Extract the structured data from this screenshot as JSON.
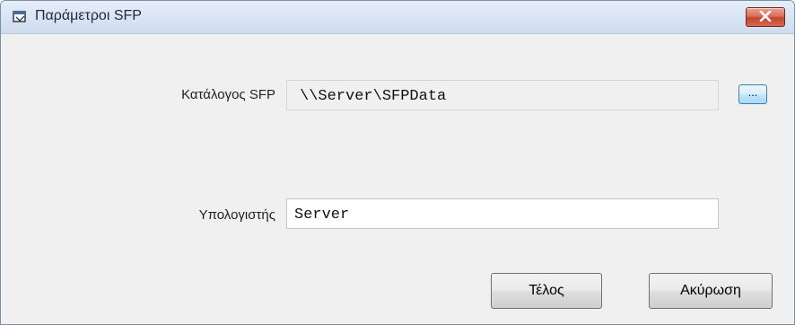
{
  "window": {
    "title": "Παράμετροι SFP",
    "close_label": "X"
  },
  "form": {
    "directory": {
      "label": "Κατάλογος SFP",
      "value": "\\\\Server\\SFPData",
      "browse_label": "..."
    },
    "computer": {
      "label": "Υπολογιστής",
      "value": "Server"
    }
  },
  "buttons": {
    "ok_label": "Τέλος",
    "cancel_label": "Ακύρωση"
  }
}
